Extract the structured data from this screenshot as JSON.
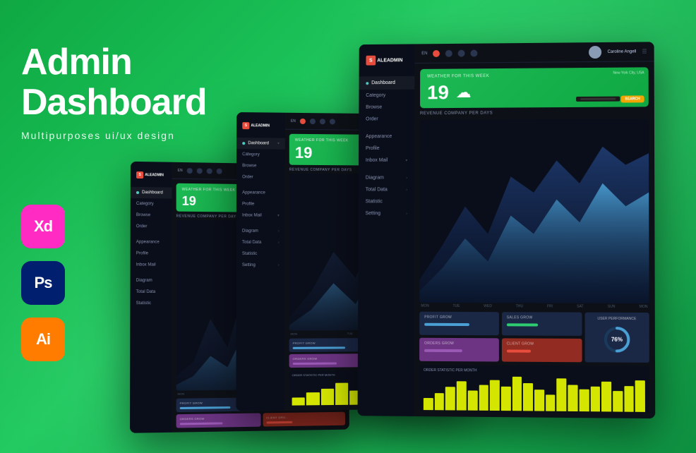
{
  "hero": {
    "title_line1": "Admin",
    "title_line2": "Dashboard",
    "subtitle": "Multipurposes ui/ux design"
  },
  "tools": [
    {
      "id": "xd",
      "label": "Xd",
      "color": "#ff2bc2"
    },
    {
      "id": "ps",
      "label": "Ps",
      "color": "#001f6e"
    },
    {
      "id": "ai",
      "label": "Ai",
      "color": "#ff7c00"
    }
  ],
  "dashboard": {
    "logo": "SALEADMIN",
    "topbar_lang": "EN",
    "user_name": "Caroline Angell",
    "nav_items": [
      "Dashboard",
      "Category",
      "Browse",
      "Order",
      "",
      "Appearance",
      "Profile",
      "Inbox Mail",
      "",
      "Diagram",
      "Total Data",
      "Statistic",
      "Setting"
    ],
    "weather": {
      "title": "WEATHER FOR THIS WEEK",
      "temp": "19",
      "location": "New York City, USA",
      "search_label": "SEARCH"
    },
    "revenue": {
      "title": "REVENUE COMPANY PER DAYS",
      "x_labels": [
        "MON",
        "TUE",
        "WED",
        "THU",
        "FRI",
        "SAT",
        "SUN",
        "MON"
      ]
    },
    "stats": [
      {
        "label": "PROFIT GROW",
        "bar_width": "65",
        "color": "#4a9fd4"
      },
      {
        "label": "SALES GROW",
        "bar_width": "45",
        "color": "#2ecc71"
      },
      {
        "label": "ORDERS GROW",
        "bar_width": "55",
        "color": "#9b59b6"
      },
      {
        "label": "CLIENT GROW",
        "bar_width": "35",
        "color": "#e74c3c"
      }
    ],
    "performance": {
      "label": "USER PERFORMANCE",
      "value": "76%"
    },
    "bar_chart": {
      "title": "ORDER STATISTIC PER MONTH",
      "bars": [
        30,
        45,
        60,
        80,
        55,
        70,
        85,
        65,
        90,
        75,
        50,
        40,
        95,
        80,
        65,
        70,
        85,
        60,
        75,
        90
      ]
    }
  }
}
